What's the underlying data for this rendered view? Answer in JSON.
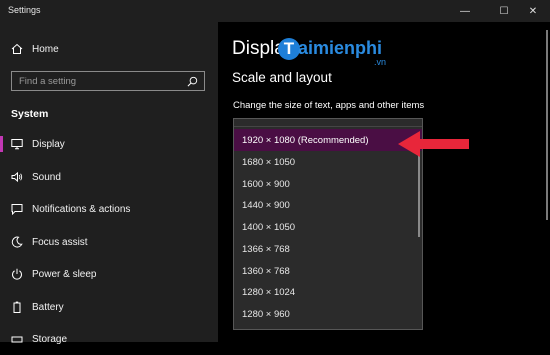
{
  "window": {
    "title": "Settings",
    "min_glyph": "—",
    "max_glyph": "☐",
    "close_glyph": "✕"
  },
  "sidebar": {
    "home_label": "Home",
    "search_placeholder": "Find a setting",
    "section_label": "System",
    "items": [
      {
        "label": "Display",
        "icon": "monitor-icon",
        "active": true
      },
      {
        "label": "Sound",
        "icon": "speaker-icon"
      },
      {
        "label": "Notifications & actions",
        "icon": "notification-icon"
      },
      {
        "label": "Focus assist",
        "icon": "moon-icon"
      },
      {
        "label": "Power & sleep",
        "icon": "power-icon"
      },
      {
        "label": "Battery",
        "icon": "battery-icon"
      },
      {
        "label": "Storage",
        "icon": "storage-icon"
      }
    ]
  },
  "main": {
    "page_title": "Display",
    "subheading": "Scale and layout",
    "description": "Change the size of text, apps and other items"
  },
  "watermark": {
    "brand": "aimienphi",
    "logo_letter": "T",
    "suffix": ".vn"
  },
  "resolution_dropdown": {
    "selected": "1920 × 1080 (Recommended)",
    "options": [
      "1920 × 1080 (Recommended)",
      "1680 × 1050",
      "1600 × 900",
      "1440 × 900",
      "1400 × 1050",
      "1366 × 768",
      "1360 × 768",
      "1280 × 1024",
      "1280 × 960"
    ]
  },
  "colors": {
    "accent": "#c238b4",
    "selected_bg": "#4a0e44",
    "arrow": "#e8263a",
    "watermark": "#2a8be0"
  }
}
